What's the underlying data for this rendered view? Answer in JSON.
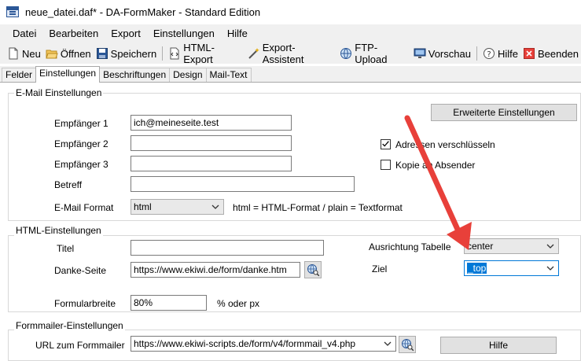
{
  "window": {
    "title": "neue_datei.daf* - DA-FormMaker  - Standard Edition"
  },
  "menu": [
    "Datei",
    "Bearbeiten",
    "Export",
    "Einstellungen",
    "Hilfe"
  ],
  "toolbar": {
    "neu": "Neu",
    "oeffnen": "Öffnen",
    "speichern": "Speichern",
    "html_export": "HTML-Export",
    "export_assistent": "Export-Assistent",
    "ftp_upload": "FTP-Upload",
    "vorschau": "Vorschau",
    "hilfe": "Hilfe",
    "beenden": "Beenden"
  },
  "tabs": [
    "Felder",
    "Einstellungen",
    "Beschriftungen",
    "Design",
    "Mail-Text"
  ],
  "email": {
    "legend": "E-Mail Einstellungen",
    "erweitert_button": "Erweiterte Einstellungen",
    "empfaenger1_label": "Empfänger 1",
    "empfaenger1_value": "ich@meineseite.test",
    "empfaenger2_label": "Empfänger 2",
    "empfaenger3_label": "Empfänger 3",
    "betreff_label": "Betreff",
    "format_label": "E-Mail Format",
    "format_value": "html",
    "format_hint": "html = HTML-Format / plain = Textformat",
    "verschluesseln_label": "Adressen verschlüsseln",
    "verschluesseln_checked": true,
    "kopie_label": "Kopie an Absender",
    "kopie_checked": false
  },
  "html": {
    "legend": "HTML-Einstellungen",
    "titel_label": "Titel",
    "danke_label": "Danke-Seite",
    "danke_value": "https://www.ekiwi.de/form/danke.htm",
    "ausrichtung_label": "Ausrichtung Tabelle",
    "ausrichtung_value": "center",
    "ziel_label": "Ziel",
    "ziel_value": "_top",
    "breite_label": "Formularbreite",
    "breite_value": "80%",
    "breite_hint": "% oder px"
  },
  "formmailer": {
    "legend": "Formmailer-Einstellungen",
    "url_label": "URL zum Formmailer",
    "url_value": "https://www.ekiwi-scripts.de/form/v4/formmail_v4.php",
    "hilfe_button": "Hilfe"
  },
  "colors": {
    "accent": "#0078d7",
    "annotation_arrow": "#e8403a"
  }
}
